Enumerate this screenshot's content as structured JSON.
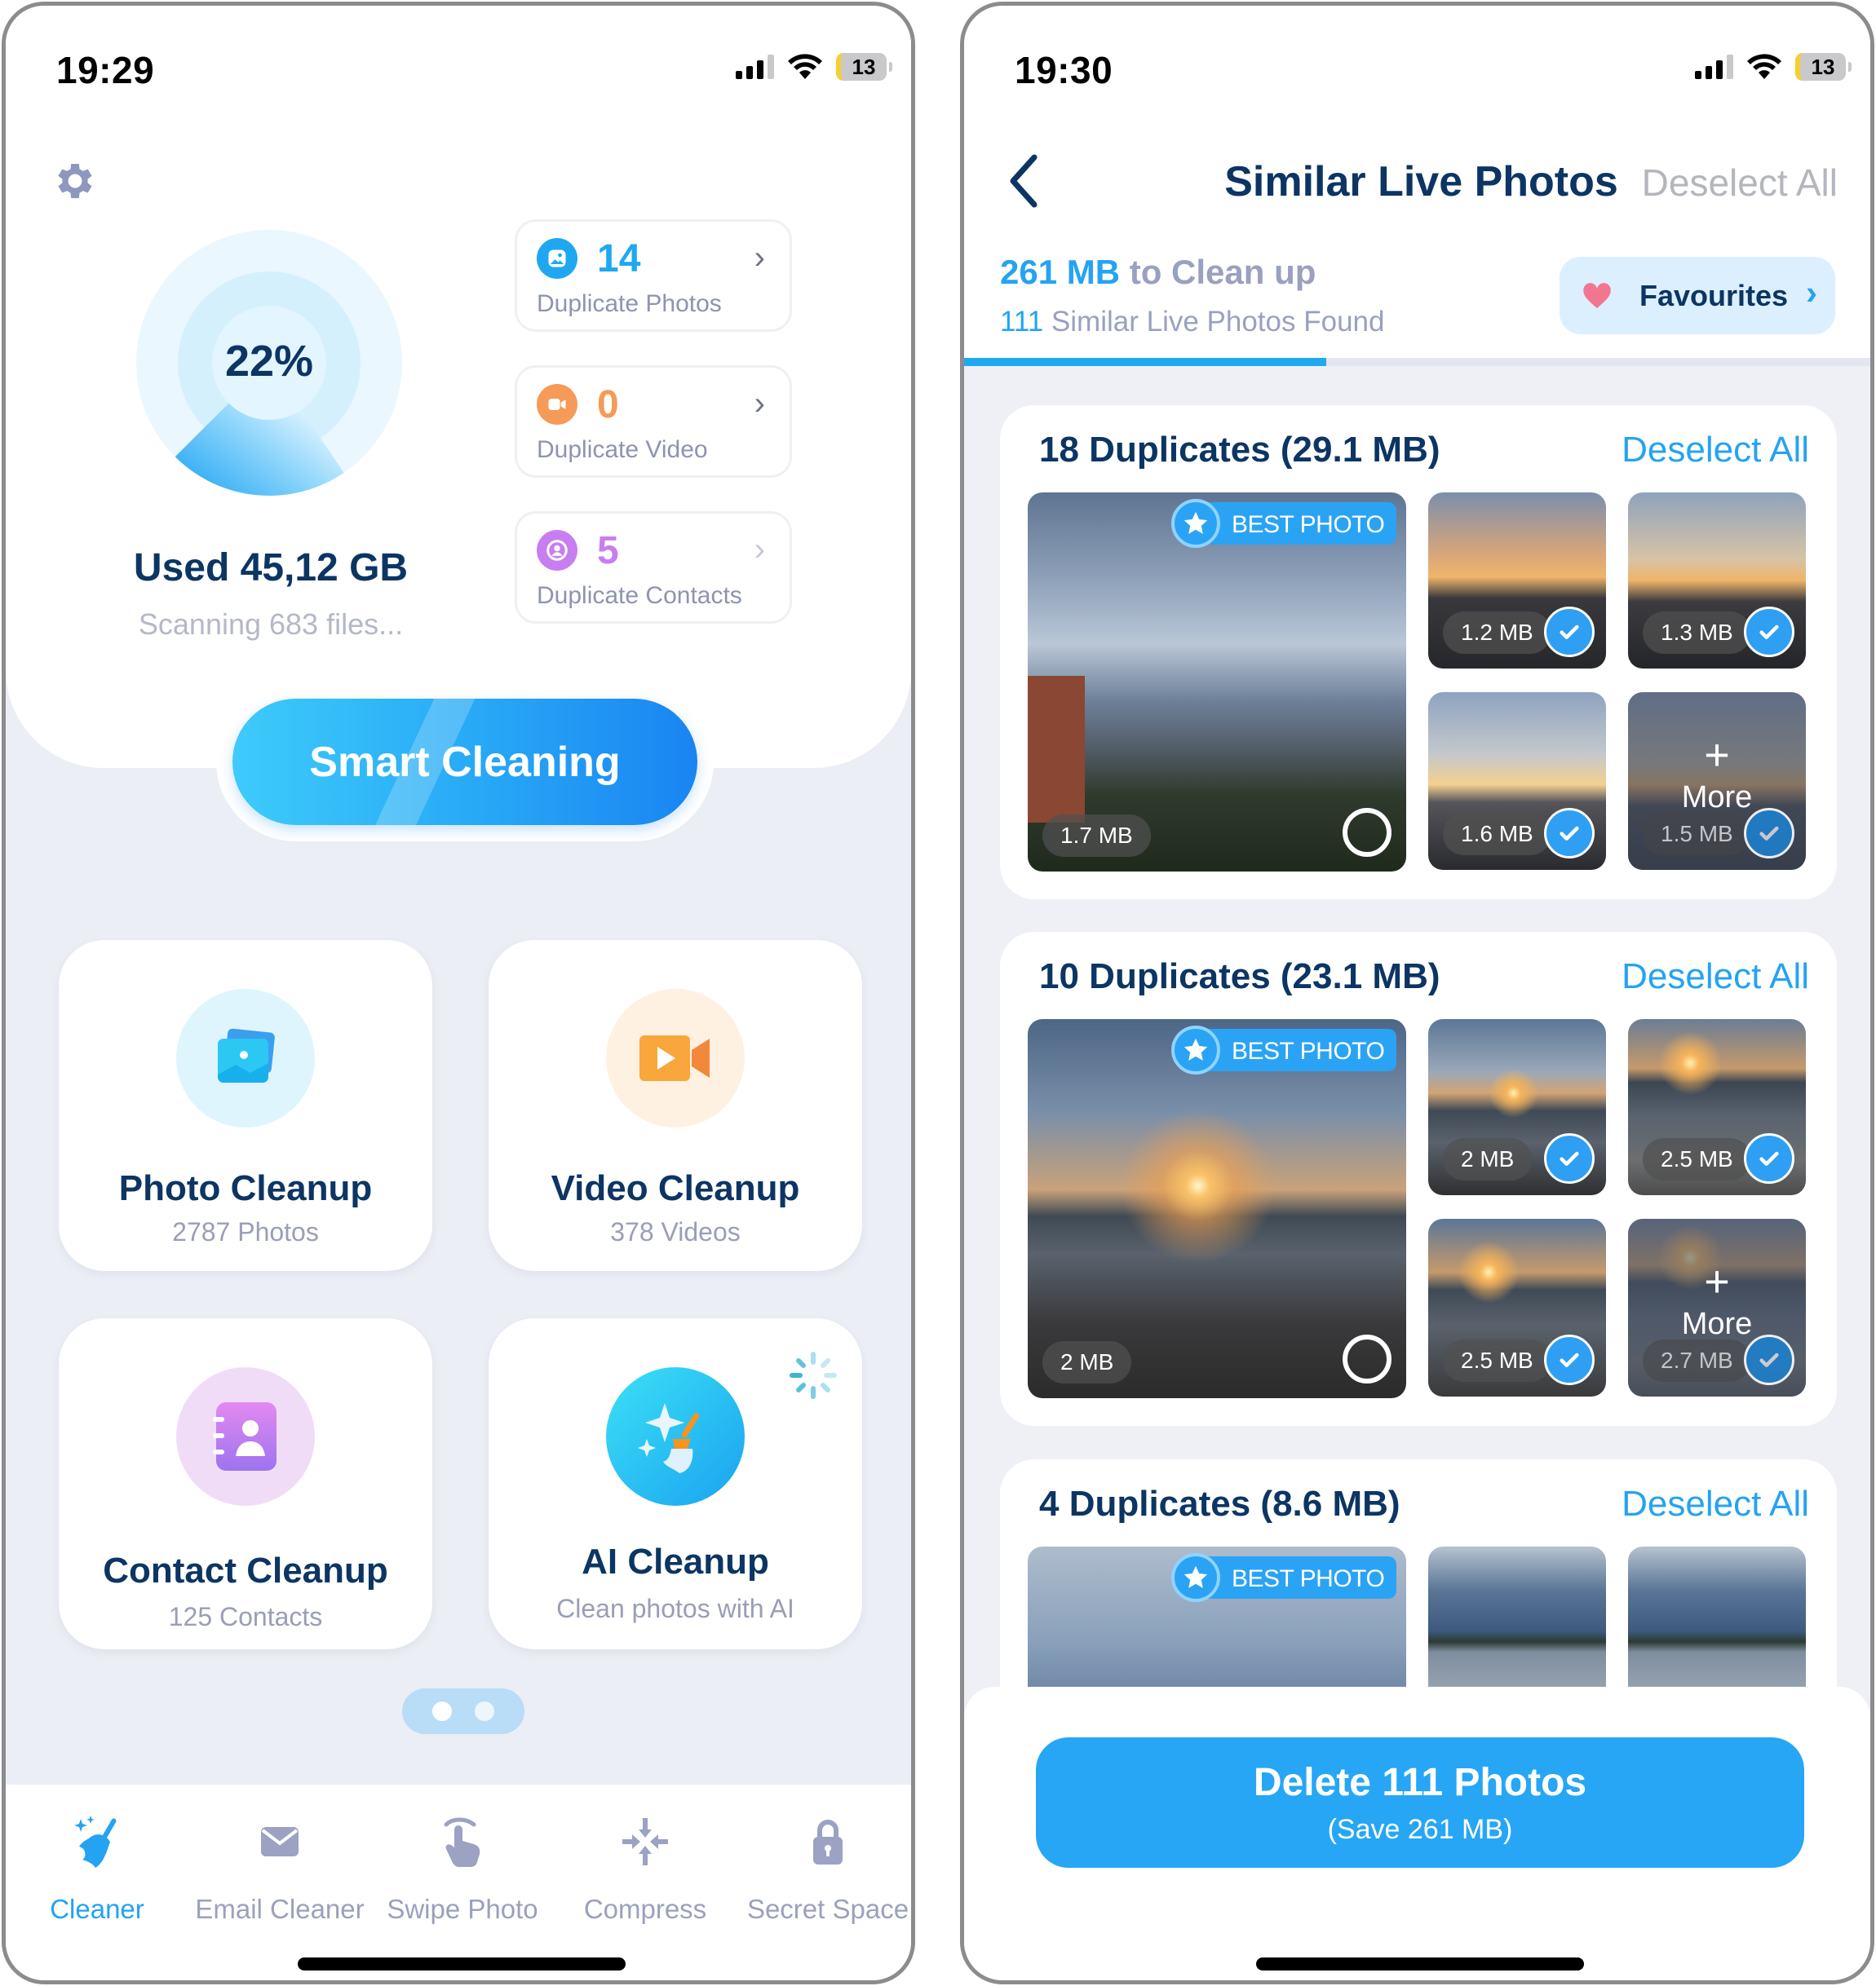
{
  "left_screen": {
    "status_bar": {
      "time": "19:29",
      "battery": "13"
    },
    "storage": {
      "used_percent": 22,
      "percent_label": "22%",
      "used_label": "Used 45,12 GB",
      "scanning_label": "Scanning 683 files..."
    },
    "duplicate_cards": [
      {
        "count": "14",
        "label": "Duplicate Photos",
        "icon": "photo-icon",
        "color": "#1fa8f1"
      },
      {
        "count": "0",
        "label": "Duplicate Video",
        "icon": "video-icon",
        "color": "#f59a57"
      },
      {
        "count": "5",
        "label": "Duplicate Contacts",
        "icon": "contact-icon",
        "color": "#c77ef0"
      }
    ],
    "smart_cleaning_label": "Smart Cleaning",
    "features": [
      {
        "title": "Photo Cleanup",
        "subtitle": "2787 Photos",
        "icon": "photo-stack-icon"
      },
      {
        "title": "Video Cleanup",
        "subtitle": "378 Videos",
        "icon": "video-camera-icon"
      },
      {
        "title": "Contact Cleanup",
        "subtitle": "125 Contacts",
        "icon": "contact-book-icon"
      },
      {
        "title": "AI Cleanup",
        "subtitle": "Clean photos with AI",
        "icon": "ai-broom-icon"
      }
    ],
    "pager": {
      "pages": 2,
      "current": 1
    },
    "tabs": [
      {
        "label": "Cleaner",
        "icon": "broom-icon",
        "active": true
      },
      {
        "label": "Email Cleaner",
        "icon": "mail-icon",
        "active": false
      },
      {
        "label": "Swipe Photo",
        "icon": "swipe-hand-icon",
        "active": false
      },
      {
        "label": "Compress",
        "icon": "compress-icon",
        "active": false
      },
      {
        "label": "Secret Space",
        "icon": "lock-icon",
        "active": false
      }
    ]
  },
  "right_screen": {
    "status_bar": {
      "time": "19:30",
      "battery": "13"
    },
    "nav": {
      "title": "Similar Live Photos",
      "deselect_all": "Deselect All"
    },
    "summary": {
      "size_value": "261 MB",
      "size_suffix": " to Clean up",
      "found_count": "111",
      "found_suffix": " Similar Live Photos Found"
    },
    "favourites_label": "Favourites",
    "scan_progress": 0.4,
    "groups": [
      {
        "title": "18 Duplicates (29.1 MB)",
        "deselect": "Deselect All",
        "best_label": "BEST PHOTO",
        "photos": [
          {
            "size": "1.7 MB",
            "selected": false,
            "best": true
          },
          {
            "size": "1.2 MB",
            "selected": true
          },
          {
            "size": "1.3 MB",
            "selected": true
          },
          {
            "size": "1.6 MB",
            "selected": true
          },
          {
            "size": "1.5 MB",
            "selected": true,
            "more": true
          }
        ],
        "more_label": "More"
      },
      {
        "title": "10 Duplicates (23.1 MB)",
        "deselect": "Deselect All",
        "best_label": "BEST PHOTO",
        "photos": [
          {
            "size": "2 MB",
            "selected": false,
            "best": true
          },
          {
            "size": "2 MB",
            "selected": true
          },
          {
            "size": "2.5 MB",
            "selected": true
          },
          {
            "size": "2.5 MB",
            "selected": true
          },
          {
            "size": "2.7 MB",
            "selected": true,
            "more": true
          }
        ],
        "more_label": "More"
      },
      {
        "title": "4 Duplicates (8.6 MB)",
        "deselect": "Deselect All",
        "best_label": "BEST PHOTO"
      }
    ],
    "delete_button": {
      "label": "Delete 111 Photos",
      "sublabel": "(Save 261 MB)"
    }
  }
}
